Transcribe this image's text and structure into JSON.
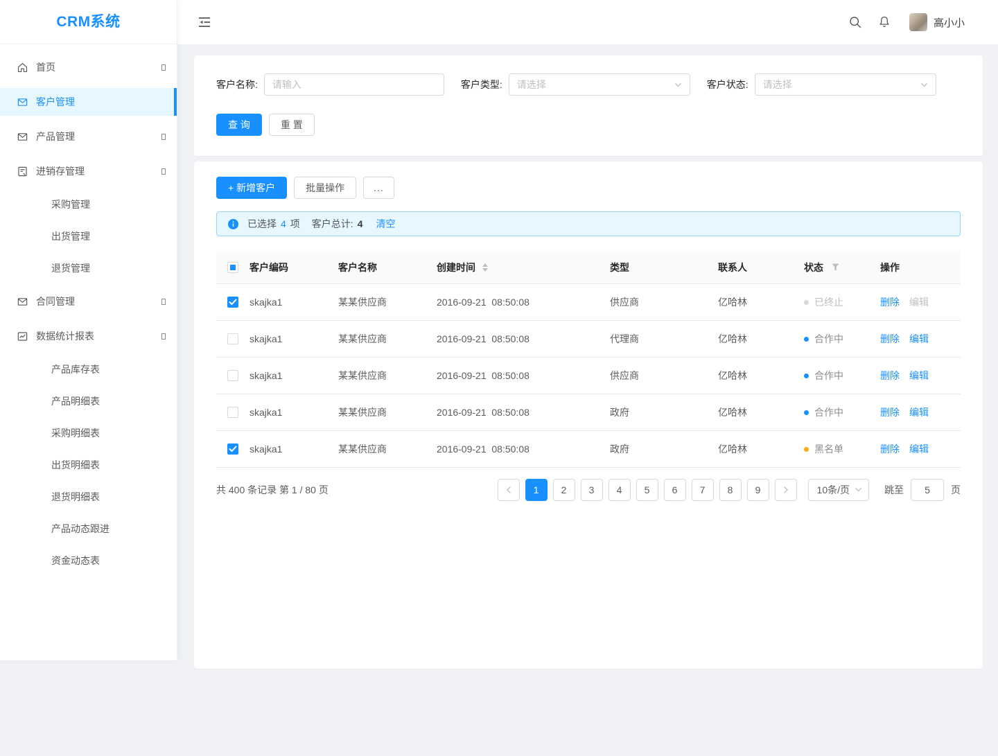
{
  "app": {
    "title": "CRM系统",
    "user_name": "高小小"
  },
  "sidebar": {
    "items": [
      {
        "label": "首页"
      },
      {
        "label": "客户管理"
      },
      {
        "label": "产品管理"
      },
      {
        "label": "进销存管理"
      },
      {
        "label": "采购管理"
      },
      {
        "label": "出货管理"
      },
      {
        "label": "退货管理"
      },
      {
        "label": "合同管理"
      },
      {
        "label": "数据统计报表"
      },
      {
        "label": "产品库存表"
      },
      {
        "label": "产品明细表"
      },
      {
        "label": "采购明细表"
      },
      {
        "label": "出货明细表"
      },
      {
        "label": "退货明细表"
      },
      {
        "label": "产品动态跟进"
      },
      {
        "label": "资金动态表"
      }
    ]
  },
  "filter": {
    "name_label": "客户名称:",
    "name_placeholder": "请输入",
    "type_label": "客户类型:",
    "type_placeholder": "请选择",
    "status_label": "客户状态:",
    "status_placeholder": "请选择",
    "search_label": "查 询",
    "reset_label": "重 置"
  },
  "toolbar": {
    "add_label": "+ 新增客户",
    "batch_label": "批量操作",
    "more_label": "..."
  },
  "alert": {
    "selected_prefix": "已选择",
    "selected_count": "4",
    "selected_suffix": "项",
    "total_label": "客户总计:",
    "total_value": "4",
    "clear_label": "清空"
  },
  "table": {
    "columns": [
      "客户编码",
      "客户名称",
      "创建时间",
      "类型",
      "联系人",
      "状态",
      "操作"
    ],
    "actions": {
      "delete": "删除",
      "edit": "编辑"
    },
    "rows": [
      {
        "checked": true,
        "code": "skajka1",
        "name": "某某供应商",
        "created": "2016-09-21  08:50:08",
        "type": "供应商",
        "contact": "亿哈林",
        "status": "已终止",
        "status_color": "#d9d9d9",
        "status_text_color": "#bdbdbd",
        "edit_disabled": true
      },
      {
        "checked": false,
        "code": "skajka1",
        "name": "某某供应商",
        "created": "2016-09-21  08:50:08",
        "type": "代理商",
        "contact": "亿哈林",
        "status": "合作中",
        "status_color": "#1890ff",
        "status_text_color": "#8c8c8c",
        "edit_disabled": false
      },
      {
        "checked": false,
        "code": "skajka1",
        "name": "某某供应商",
        "created": "2016-09-21  08:50:08",
        "type": "供应商",
        "contact": "亿哈林",
        "status": "合作中",
        "status_color": "#1890ff",
        "status_text_color": "#8c8c8c",
        "edit_disabled": false
      },
      {
        "checked": false,
        "code": "skajka1",
        "name": "某某供应商",
        "created": "2016-09-21  08:50:08",
        "type": "政府",
        "contact": "亿哈林",
        "status": "合作中",
        "status_color": "#1890ff",
        "status_text_color": "#8c8c8c",
        "edit_disabled": false
      },
      {
        "checked": true,
        "code": "skajka1",
        "name": "某某供应商",
        "created": "2016-09-21  08:50:08",
        "type": "政府",
        "contact": "亿哈林",
        "status": "黑名单",
        "status_color": "#faad14",
        "status_text_color": "#8c8c8c",
        "edit_disabled": false
      }
    ]
  },
  "pagination": {
    "summary": "共 400 条记录 第 1 / 80 页",
    "pages": [
      "1",
      "2",
      "3",
      "4",
      "5",
      "6",
      "7",
      "8",
      "9"
    ],
    "actives": [
      true,
      false,
      false,
      false,
      false,
      false,
      false,
      false,
      false
    ],
    "size_label": "10条/页",
    "jump_prefix": "跳至",
    "jump_value": "5",
    "jump_suffix": "页"
  },
  "colors": {
    "primary": "#1890ff",
    "alert_bg": "#e6f7ff",
    "alert_border": "#91d5ff"
  }
}
